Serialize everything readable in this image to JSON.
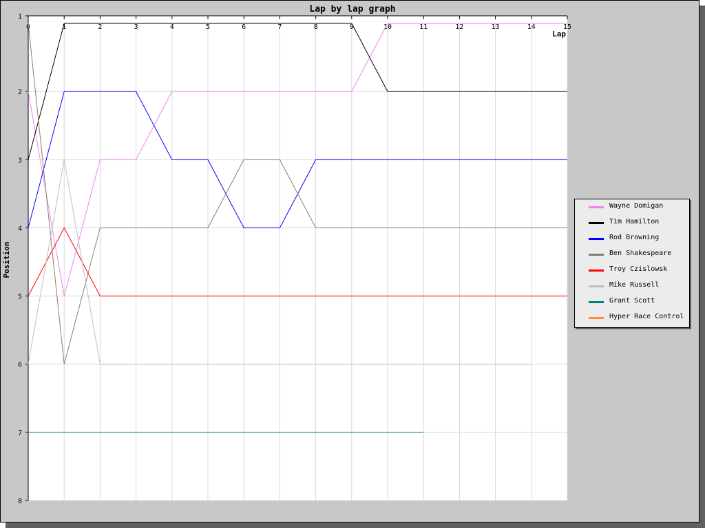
{
  "chart_data": {
    "type": "line",
    "title": "Lap by lap graph",
    "xlabel": "Lap",
    "ylabel": "Position",
    "xlim": [
      0,
      15
    ],
    "ylim": [
      1,
      8
    ],
    "y_inverted": true,
    "grid": true,
    "legend_position": "right",
    "x_ticks": [
      "0",
      "1",
      "2",
      "3",
      "4",
      "5",
      "6",
      "7",
      "8",
      "9",
      "10",
      "11",
      "12",
      "13",
      "14",
      "15"
    ],
    "y_ticks": [
      "1",
      "2",
      "3",
      "4",
      "5",
      "6",
      "7",
      "8"
    ],
    "series": [
      {
        "name": "Wayne Domigan",
        "color": "#ee82ee",
        "x": [
          0,
          1,
          2,
          3,
          4,
          5,
          6,
          7,
          8,
          9,
          10,
          11,
          12,
          13,
          14,
          15
        ],
        "values": [
          2,
          5,
          3,
          3,
          2,
          2,
          2,
          2,
          2,
          2,
          1,
          1,
          1,
          1,
          1,
          1
        ]
      },
      {
        "name": "Tim Hamilton",
        "color": "#000000",
        "x": [
          0,
          1,
          2,
          3,
          4,
          5,
          6,
          7,
          8,
          9,
          10,
          11,
          12,
          13,
          14,
          15
        ],
        "values": [
          3,
          1,
          1,
          1,
          1,
          1,
          1,
          1,
          1,
          1,
          2,
          2,
          2,
          2,
          2,
          2
        ]
      },
      {
        "name": "Rod Browning",
        "color": "#0000ff",
        "x": [
          0,
          1,
          2,
          3,
          4,
          5,
          6,
          7,
          8,
          9,
          10,
          11,
          12,
          13,
          14,
          15
        ],
        "values": [
          4,
          2,
          2,
          2,
          3,
          3,
          4,
          4,
          3,
          3,
          3,
          3,
          3,
          3,
          3,
          3
        ]
      },
      {
        "name": "Ben Shakespeare",
        "color": "#8b7d6b",
        "x": [
          0,
          1,
          2,
          3,
          4,
          5,
          6,
          7,
          8,
          9,
          10,
          11,
          12,
          13,
          14,
          15
        ],
        "values": [
          1,
          6,
          4,
          4,
          4,
          4,
          3,
          3,
          4,
          4,
          4,
          4,
          4,
          4,
          4,
          4
        ]
      },
      {
        "name": "Troy Czislowsk",
        "color": "#ff0000",
        "x": [
          0,
          1,
          2,
          3,
          4,
          5,
          6,
          7,
          8,
          9,
          10,
          11,
          12,
          13,
          14,
          15
        ],
        "values": [
          5,
          4,
          5,
          5,
          5,
          5,
          5,
          5,
          5,
          5,
          5,
          5,
          5,
          5,
          5,
          5
        ]
      },
      {
        "name": "Mike Russell",
        "color": "#bebebe",
        "x": [
          0,
          1,
          2,
          3,
          4,
          5,
          6,
          7,
          8,
          9,
          10,
          11,
          12,
          13,
          14
        ],
        "values": [
          6,
          3,
          6,
          6,
          6,
          6,
          6,
          6,
          6,
          6,
          6,
          6,
          6,
          6,
          6
        ]
      },
      {
        "name": "Grant Scott",
        "color": "#008080",
        "x": [
          0,
          1,
          2,
          3,
          4,
          5,
          6,
          7,
          8,
          9,
          10,
          11
        ],
        "values": [
          7,
          7,
          7,
          7,
          7,
          7,
          7,
          7,
          7,
          7,
          7,
          7
        ]
      },
      {
        "name": "Hyper Race Control",
        "color": "#ff8c3c",
        "x": [],
        "values": []
      }
    ]
  }
}
